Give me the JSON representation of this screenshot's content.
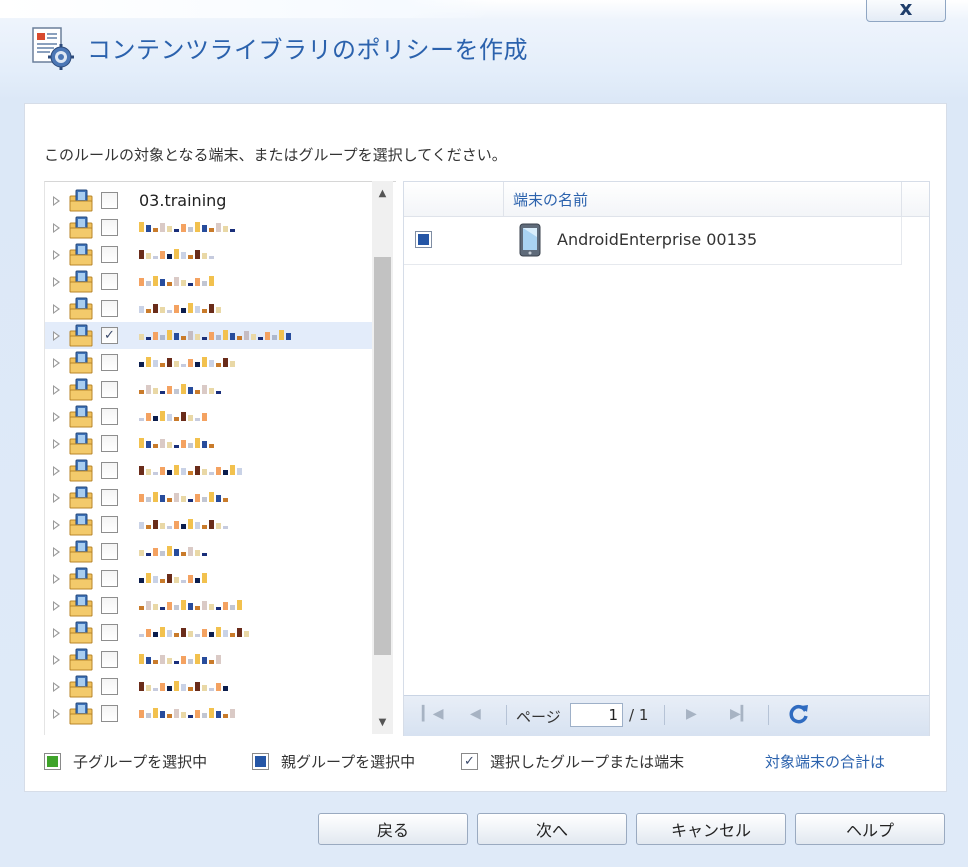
{
  "window": {
    "title": "コンテンツライブラリのポリシーを作成",
    "close_glyph": "x"
  },
  "instruction": "このルールの対象となる端末、またはグループを選択してください。",
  "tree": {
    "items": [
      {
        "label": "03.training",
        "checked": false,
        "selected": false,
        "redacted": false
      },
      {
        "label": "",
        "checked": false,
        "selected": false,
        "redacted": true
      },
      {
        "label": "",
        "checked": false,
        "selected": false,
        "redacted": true
      },
      {
        "label": "",
        "checked": false,
        "selected": false,
        "redacted": true
      },
      {
        "label": "",
        "checked": false,
        "selected": false,
        "redacted": true
      },
      {
        "label": "",
        "checked": true,
        "selected": true,
        "redacted": true
      },
      {
        "label": "",
        "checked": false,
        "selected": false,
        "redacted": true
      },
      {
        "label": "",
        "checked": false,
        "selected": false,
        "redacted": true
      },
      {
        "label": "",
        "checked": false,
        "selected": false,
        "redacted": true
      },
      {
        "label": "",
        "checked": false,
        "selected": false,
        "redacted": true
      },
      {
        "label": "",
        "checked": false,
        "selected": false,
        "redacted": true
      },
      {
        "label": "",
        "checked": false,
        "selected": false,
        "redacted": true
      },
      {
        "label": "",
        "checked": false,
        "selected": false,
        "redacted": true
      },
      {
        "label": "",
        "checked": false,
        "selected": false,
        "redacted": true
      },
      {
        "label": "",
        "checked": false,
        "selected": false,
        "redacted": true
      },
      {
        "label": "",
        "checked": false,
        "selected": false,
        "redacted": true
      },
      {
        "label": "",
        "checked": false,
        "selected": false,
        "redacted": true
      },
      {
        "label": "",
        "checked": false,
        "selected": false,
        "redacted": true
      },
      {
        "label": "",
        "checked": false,
        "selected": false,
        "redacted": true
      },
      {
        "label": "",
        "checked": false,
        "selected": false,
        "redacted": true
      }
    ]
  },
  "grid": {
    "column_header": "端末の名前",
    "rows": [
      {
        "device_name": "AndroidEnterprise 00135",
        "selected_state": "parent-group"
      }
    ]
  },
  "pager": {
    "page_label": "ページ",
    "current_page": "1",
    "total": "/ 1"
  },
  "legend": {
    "child_group": "子グループを選択中",
    "parent_group": "親グループを選択中",
    "selected": "選択したグループまたは端末",
    "total_link": "対象端末の合計は",
    "child_color": "#3fa32a",
    "parent_color": "#2556a6"
  },
  "buttons": {
    "back": "戻る",
    "next": "次へ",
    "cancel": "キャンセル",
    "help": "ヘルプ"
  }
}
